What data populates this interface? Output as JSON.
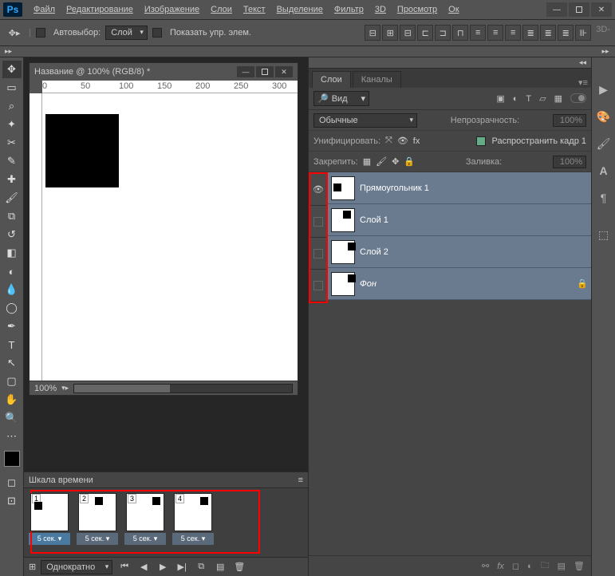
{
  "app": {
    "logo": "Ps"
  },
  "menu": [
    "Файл",
    "Редактирование",
    "Изображение",
    "Слои",
    "Текст",
    "Выделение",
    "Фильтр",
    "3D",
    "Просмотр",
    "Ок"
  ],
  "optbar": {
    "auto": "Автовыбор:",
    "layer": "Слой",
    "show": "Показать упр. элем.",
    "threeD": "3D-"
  },
  "doc": {
    "title": "Название @ 100% (RGB/8) *",
    "ruler": [
      "0",
      "50",
      "100",
      "150",
      "200",
      "250",
      "300"
    ],
    "zoom": "100%"
  },
  "panel": {
    "tabs": [
      "Слои",
      "Каналы"
    ],
    "search": "Вид",
    "blend": "Обычные",
    "opacityLbl": "Непрозрачность:",
    "opacity": "100%",
    "unify": "Унифицировать:",
    "propagate": "Распространить кадр 1",
    "lockLbl": "Закрепить:",
    "fillLbl": "Заливка:",
    "fill": "100%"
  },
  "layers": [
    {
      "name": "Прямоугольник 1",
      "eye": true,
      "sq": {
        "l": 2,
        "t": 8
      },
      "lock": false
    },
    {
      "name": "Слой 1",
      "eye": false,
      "sq": {
        "l": 14,
        "t": 2
      },
      "lock": false
    },
    {
      "name": "Слой 2",
      "eye": false,
      "sq": {
        "l": 20,
        "t": 2
      },
      "lock": false
    },
    {
      "name": "Фон",
      "eye": false,
      "sq": {
        "l": 20,
        "t": 2
      },
      "lock": true,
      "italic": true
    }
  ],
  "timeline": {
    "title": "Шкала времени",
    "frames": [
      {
        "n": "1",
        "time": "5 сек.",
        "sq": {
          "l": 4,
          "t": 10
        },
        "active": true
      },
      {
        "n": "2",
        "time": "5 сек.",
        "sq": {
          "l": 20,
          "t": 4
        }
      },
      {
        "n": "3",
        "time": "5 сек.",
        "sq": {
          "l": 32,
          "t": 4
        }
      },
      {
        "n": "4",
        "time": "5 сек.",
        "sq": {
          "l": 32,
          "t": 4
        }
      }
    ],
    "loop": "Однократно"
  },
  "winControls": {
    "min": "—",
    "max": "□",
    "close": "✕"
  }
}
